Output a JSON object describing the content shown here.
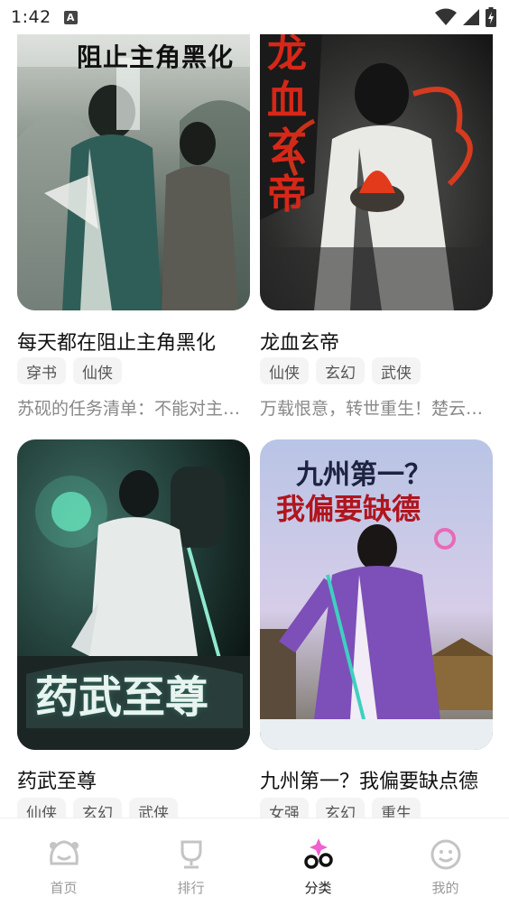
{
  "status_bar": {
    "time": "1:42",
    "notification_letter": "A"
  },
  "books": [
    {
      "title": "每天都在阻止主角黑化",
      "tags": [
        "穿书",
        "仙侠"
      ],
      "description": "苏砚的任务清单：不能对主角…",
      "cover_text": "阻止主角黑化",
      "cover_icon": "book-cover-image"
    },
    {
      "title": "龙血玄帝",
      "tags": [
        "仙侠",
        "玄幻",
        "武侠"
      ],
      "description": "万载恨意，转世重生！楚云…",
      "cover_text": "龙血玄帝",
      "cover_icon": "book-cover-image"
    },
    {
      "title": "药武至尊",
      "tags": [
        "仙侠",
        "玄幻",
        "武侠"
      ],
      "description": "",
      "cover_text": "药武至尊",
      "cover_icon": "book-cover-image"
    },
    {
      "title": "九州第一？我偏要缺点德",
      "tags": [
        "女强",
        "玄幻",
        "重生"
      ],
      "description": "",
      "cover_text_line1": "九州第一？",
      "cover_text_line2": "我偏要缺德",
      "cover_icon": "book-cover-image"
    }
  ],
  "bottom_nav": [
    {
      "label": "首页",
      "icon": "home-face-icon",
      "active": false
    },
    {
      "label": "排行",
      "icon": "trophy-icon",
      "active": false
    },
    {
      "label": "分类",
      "icon": "category-icon",
      "active": true
    },
    {
      "label": "我的",
      "icon": "smiley-icon",
      "active": false
    }
  ],
  "colors": {
    "accent": "#f060d0",
    "text_primary": "#111111",
    "text_secondary": "#888888",
    "tag_bg": "#f4f4f4"
  }
}
